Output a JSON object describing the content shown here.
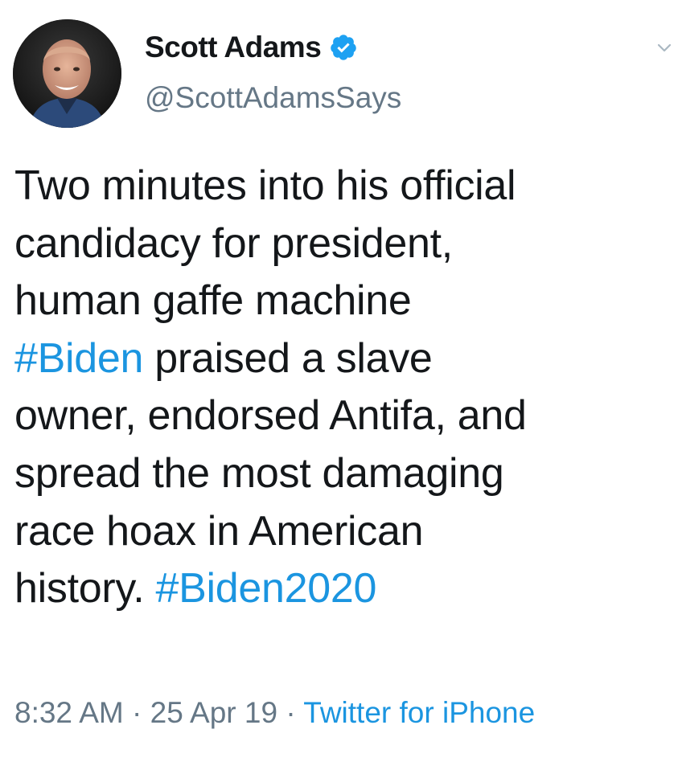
{
  "author": {
    "display_name": "Scott Adams",
    "handle": "@ScottAdamsSays",
    "verified_icon": "verified-badge-icon",
    "avatar": "profile-photo"
  },
  "menu": {
    "icon": "chevron-down-icon"
  },
  "tweet": {
    "lines": [
      {
        "text": "Two minutes into his official"
      },
      {
        "text": "candidacy for president,"
      },
      {
        "text": "human gaffe machine"
      },
      {
        "hashtag": "#Biden",
        "text": " praised a slave"
      },
      {
        "text": "owner, endorsed Antifa, and"
      },
      {
        "text": "spread the most damaging"
      },
      {
        "text": "race hoax in American"
      },
      {
        "text": "history. ",
        "hashtag": "#Biden2020"
      }
    ]
  },
  "meta": {
    "time": "8:32 AM",
    "separator": " · ",
    "date": "25 Apr 19",
    "source": "Twitter for iPhone"
  },
  "colors": {
    "text": "#14171a",
    "secondary": "#657786",
    "link": "#1b95e0",
    "verified": "#1da1f2"
  }
}
